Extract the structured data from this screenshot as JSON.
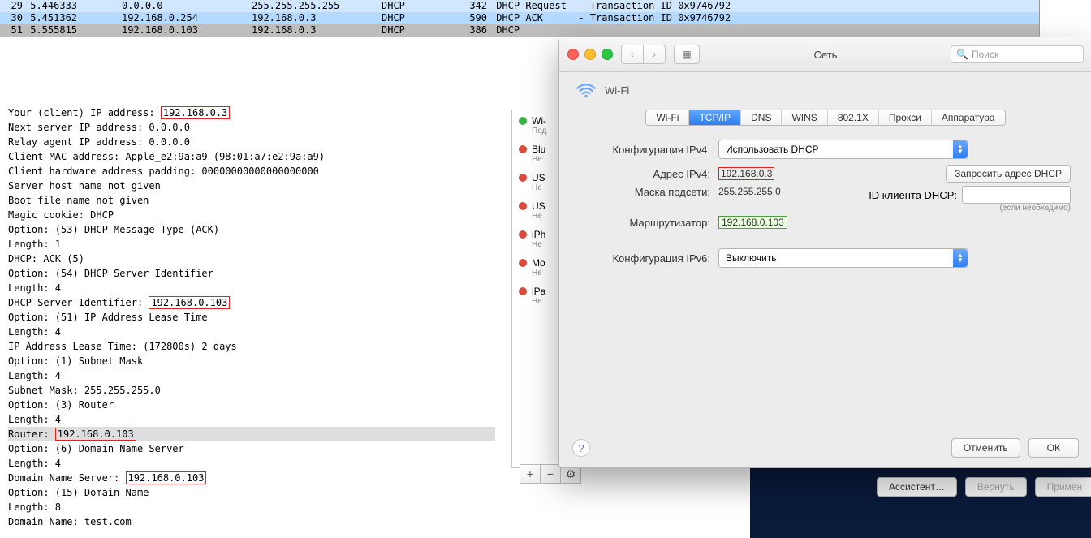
{
  "packet_list": {
    "rows": [
      {
        "no": "29",
        "time": "5.446333",
        "src": "0.0.0.0",
        "dst": "255.255.255.255",
        "proto": "DHCP",
        "len": "342",
        "info": "DHCP Request  - Transaction ID 0x9746792",
        "cls": "lightblue"
      },
      {
        "no": "30",
        "time": "5.451362",
        "src": "192.168.0.254",
        "dst": "192.168.0.3",
        "proto": "DHCP",
        "len": "590",
        "info": "DHCP ACK      - Transaction ID 0x9746792",
        "cls": "midblue"
      },
      {
        "no": "51",
        "time": "5.555815",
        "src": "192.168.0.103",
        "dst": "192.168.0.3",
        "proto": "DHCP",
        "len": "386",
        "info": "DHCP",
        "cls": "grey"
      }
    ]
  },
  "detail": {
    "l1a": "Your (client) IP address: ",
    "l1b": "192.168.0.3",
    "l2": "Next server IP address: 0.0.0.0",
    "l3": "Relay agent IP address: 0.0.0.0",
    "l4": "Client MAC address: Apple_e2:9a:a9 (98:01:a7:e2:9a:a9)",
    "l5": "Client hardware address padding: 00000000000000000000",
    "l6": "Server host name not given",
    "l7": "Boot file name not given",
    "l8": "Magic cookie: DHCP",
    "l9": "Option: (53) DHCP Message Type (ACK)",
    "l10": "   Length: 1",
    "l11": "   DHCP: ACK (5)",
    "l12": "Option: (54) DHCP Server Identifier",
    "l13": "   Length: 4",
    "l14a": "   DHCP Server Identifier: ",
    "l14b": "192.168.0.103",
    "l15": "Option: (51) IP Address Lease Time",
    "l16": "   Length: 4",
    "l17": "   IP Address Lease Time: (172800s) 2 days",
    "l18": "Option: (1) Subnet Mask",
    "l19": "   Length: 4",
    "l20": "   Subnet Mask: 255.255.255.0",
    "l21": "Option: (3) Router",
    "l22": "   Length: 4",
    "l23a": "   Router: ",
    "l23b": "192.168.0.103",
    "l24": "Option: (6) Domain Name Server",
    "l25": "   Length: 4",
    "l26a": "   Domain Name Server: ",
    "l26b": "192.168.0.103",
    "l27": "Option: (15) Domain Name",
    "l28": "   Length: 8",
    "l29": "   Domain Name: test.com"
  },
  "netwin_sidebar": {
    "items": [
      {
        "dot": "green",
        "label": "Wi-",
        "sub": "Под"
      },
      {
        "dot": "red",
        "label": "Blu",
        "sub": "Не"
      },
      {
        "dot": "red",
        "label": "US",
        "sub": "Не"
      },
      {
        "dot": "red",
        "label": "US",
        "sub": "Не"
      },
      {
        "dot": "red",
        "label": "iPh",
        "sub": "Не"
      },
      {
        "dot": "red",
        "label": "Mo",
        "sub": "Не"
      },
      {
        "dot": "red",
        "label": "iPa",
        "sub": "Не"
      }
    ],
    "plus": "+",
    "minus": "−",
    "gear": "⚙"
  },
  "netwin_footer": {
    "assist": "Ассистент…",
    "revert": "Вернуть",
    "apply": "Примен"
  },
  "sheet": {
    "title": "Сеть",
    "search_placeholder": "Поиск",
    "header": "Wi-Fi",
    "tabs": [
      "Wi-Fi",
      "TCP/IP",
      "DNS",
      "WINS",
      "802.1X",
      "Прокси",
      "Аппаратура"
    ],
    "active_tab": 1,
    "ipv4_conf_label": "Конфигурация IPv4:",
    "ipv4_conf_value": "Использовать DHCP",
    "ipv4_addr_label": "Адрес IPv4:",
    "ipv4_addr_value": "192.168.0.3",
    "request_btn": "Запросить адрес DHCP",
    "mask_label": "Маска подсети:",
    "mask_value": "255.255.255.0",
    "dhcp_id_label": "ID клиента DHCP:",
    "dhcp_id_hint": "(если необходимо)",
    "router_label": "Маршрутизатор:",
    "router_value": "192.168.0.103",
    "ipv6_conf_label": "Конфигурация IPv6:",
    "ipv6_conf_value": "Выключить",
    "cancel": "Отменить",
    "ok": "ОК",
    "help": "?"
  }
}
